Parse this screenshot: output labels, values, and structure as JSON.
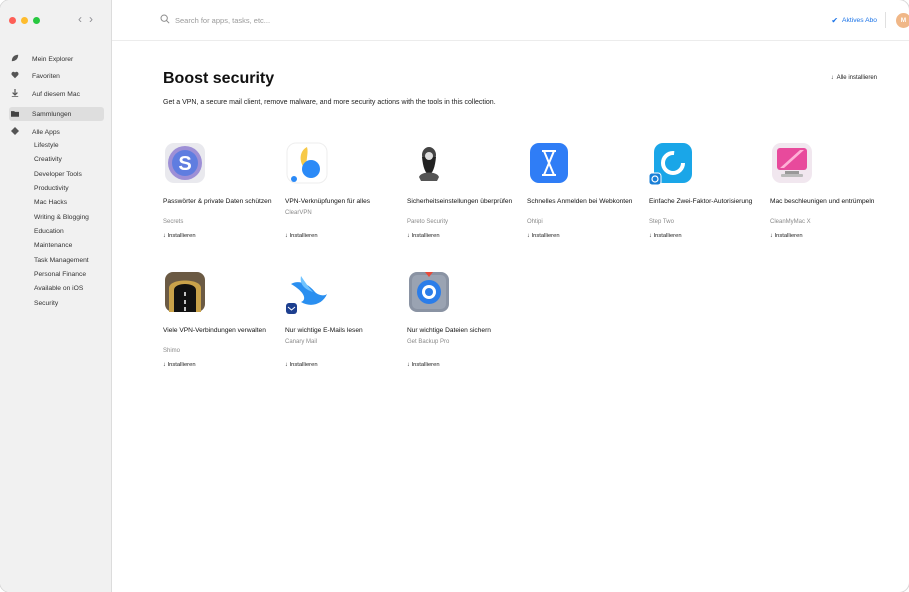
{
  "window": {
    "traffic_colors": [
      "#fe5f57",
      "#febc2e",
      "#28c840"
    ]
  },
  "nav": {
    "back": "‹",
    "forward": "›"
  },
  "sidebar": {
    "items": [
      {
        "label": "Mein Explorer",
        "icon": "leaf-icon"
      },
      {
        "label": "Favoriten",
        "icon": "heart-icon"
      },
      {
        "label": "Auf diesem Mac",
        "icon": "download-arrow-icon"
      },
      {
        "label": "Sammlungen",
        "icon": "folder-icon"
      },
      {
        "label": "Alle Apps",
        "icon": "diamond-icon"
      }
    ],
    "categories": [
      "Lifestyle",
      "Creativity",
      "Developer Tools",
      "Productivity",
      "Mac Hacks",
      "Writing & Blogging",
      "Education",
      "Maintenance",
      "Task Management",
      "Personal Finance",
      "Available on iOS",
      "Security"
    ]
  },
  "search": {
    "placeholder": "Search for apps, tasks, etc..."
  },
  "subscription": {
    "label": "Aktives Abo",
    "color": "#1a73e8"
  },
  "avatar": {
    "initial": "M"
  },
  "collection": {
    "title": "Boost security",
    "install_all": "Alle installieren",
    "description": "Get a VPN, a secure mail client, remove malware, and more security actions with the tools in this collection."
  },
  "apps": [
    {
      "name": "Passwörter & private Daten schützen",
      "developer": "Secrets",
      "install": "Installieren",
      "icon": "secrets-icon"
    },
    {
      "name": "VPN-Verknüpfungen für alles",
      "developer": "ClearVPN",
      "install": "Installieren",
      "icon": "clearvpn-icon"
    },
    {
      "name": "Sicherheitseinstellungen überprüfen",
      "developer": "Pareto Security",
      "install": "Installieren",
      "icon": "pareto-security-icon"
    },
    {
      "name": "Schnelles Anmelden bei Webkonten",
      "developer": "Ohtipi",
      "install": "Installieren",
      "icon": "ohtipi-icon"
    },
    {
      "name": "Einfache Zwei-Faktor-Autorisierung",
      "developer": "Step Two",
      "install": "Installieren",
      "icon": "step-two-icon"
    },
    {
      "name": "Mac beschleunigen und entrümpeln",
      "developer": "CleanMyMac X",
      "install": "Installieren",
      "icon": "cleanmymac-icon"
    },
    {
      "name": "Viele VPN-Verbindungen verwalten",
      "developer": "Shimo",
      "install": "Installieren",
      "icon": "shimo-icon"
    },
    {
      "name": "Nur wichtige E-Mails lesen",
      "developer": "Canary Mail",
      "install": "Installieren",
      "icon": "canary-mail-icon"
    },
    {
      "name": "Nur wichtige Dateien sichern",
      "developer": "Get Backup Pro",
      "install": "Installieren",
      "icon": "get-backup-pro-icon"
    }
  ]
}
